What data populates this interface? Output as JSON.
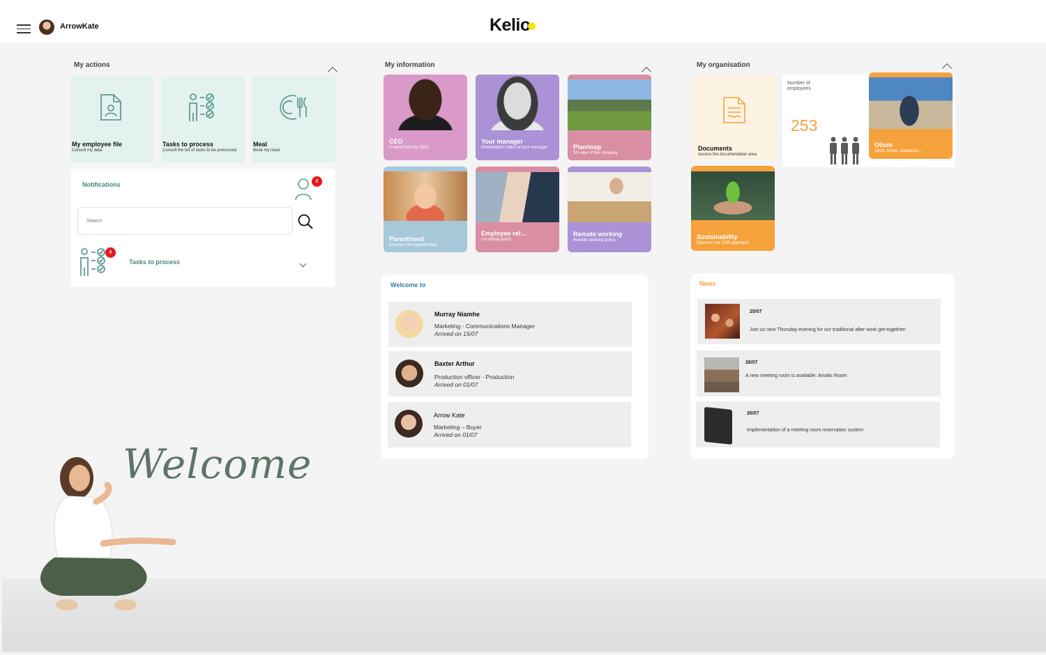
{
  "header": {
    "user_name": "ArrowKate",
    "logo": "Kelio"
  },
  "actions": {
    "title": "My actions",
    "tiles": [
      {
        "title": "My employee file",
        "subtitle": "Consult my data",
        "icon": "employee-file-icon"
      },
      {
        "title": "Tasks to process",
        "subtitle": "Consult the list of tasks to be processed",
        "icon": "tasks-checklist-icon"
      },
      {
        "title": "Meal",
        "subtitle": "Book my meal",
        "icon": "meal-icon"
      }
    ]
  },
  "notifications": {
    "title": "Notifications",
    "count": "8",
    "search_placeholder": "Search",
    "tasks_label": "Tasks to process",
    "tasks_count": "8"
  },
  "information": {
    "title": "My information",
    "tiles": [
      {
        "title": "CEO",
        "subtitle": "A word from the CEO",
        "color": "#d99ac9"
      },
      {
        "title": "Your manager",
        "subtitle": "Presentation video of your manager",
        "color": "#ab92d6"
      },
      {
        "title": "Plan/map",
        "subtitle": "3D view of the company",
        "color": "#d98ea3"
      },
      {
        "title": "Parenthood",
        "subtitle": "Discover the opportunities",
        "color": "#a6c8d9"
      },
      {
        "title": "Employee ref...",
        "subtitle": "Co-opting policy",
        "color": "#d98ea3"
      },
      {
        "title": "Remote working",
        "subtitle": "Remote working policy",
        "color": "#ab92d6"
      }
    ]
  },
  "organisation": {
    "title": "My organisation",
    "documents": {
      "title": "Documents",
      "subtitle": "Access the documentation area"
    },
    "employees": {
      "label": "Number of employees",
      "count": "253"
    },
    "otium": {
      "title": "Otium",
      "subtitle": "Sport, music, relaxation,..."
    },
    "sustainability": {
      "title": "Sustainability",
      "subtitle": "Discover our CSR approach"
    }
  },
  "welcome_to": {
    "title": "Welcome to",
    "people": [
      {
        "name": "Murray Niamhe",
        "role": "Marketing - Communications Manager",
        "arrived": "Arrived on 15/07"
      },
      {
        "name": "Baxter Arthur",
        "role": "Production officer - Production",
        "arrived": "Arrived on 01/07"
      },
      {
        "name": "Arrow Kate",
        "role": "Marketing – Buyer",
        "arrived": "Arrived on 01/07"
      }
    ]
  },
  "news": {
    "title": "News",
    "items": [
      {
        "date": "25/07",
        "text": "Join us next Thursday evening for our traditional after-work get-together!"
      },
      {
        "date": "26/07",
        "text": "A new meeting room is available: Amalis Room"
      },
      {
        "date": "26/07",
        "text": "Implementation of a meeting room reservation system"
      }
    ]
  },
  "welcome_banner": "Welcome",
  "colors": {
    "accent_green": "#3d8a83",
    "tile_mint": "#e3f1ef",
    "orange": "#f5a23c",
    "cream": "#fdf3e3",
    "badge_red": "#e21a1a"
  }
}
